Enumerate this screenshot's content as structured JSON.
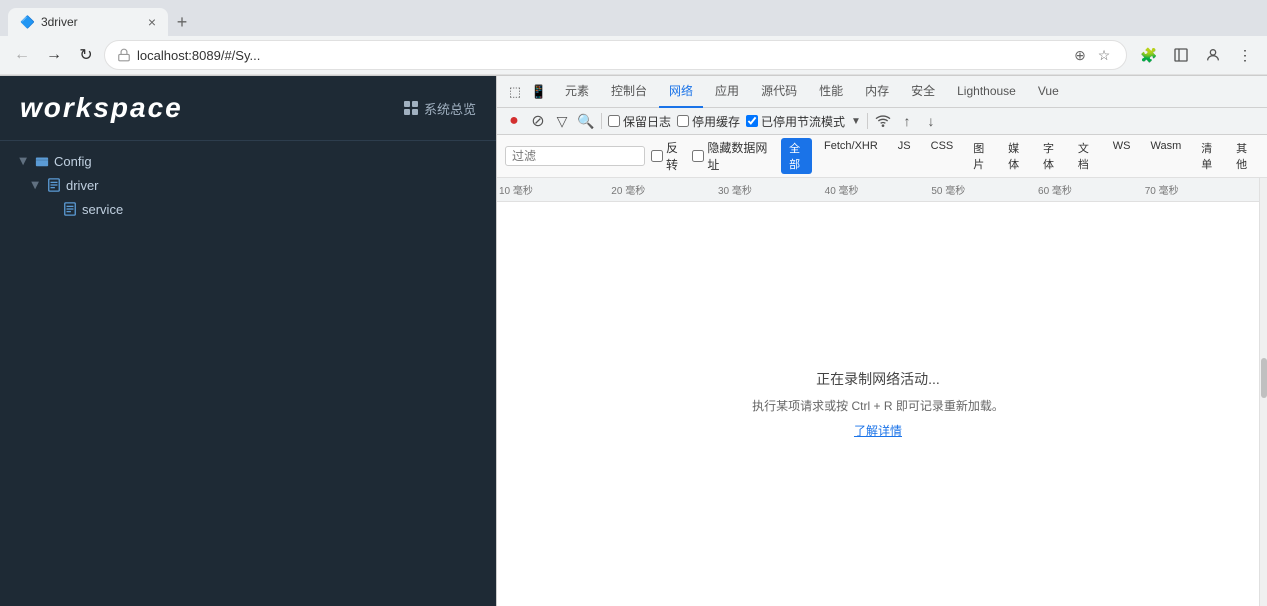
{
  "browser": {
    "tab_title": "3driver",
    "address": "localhost:8089/#/Sy...",
    "new_tab_label": "+"
  },
  "devtools": {
    "tabs": [
      {
        "id": "elements",
        "label": "元素"
      },
      {
        "id": "console",
        "label": "控制台"
      },
      {
        "id": "network",
        "label": "网络",
        "active": true
      },
      {
        "id": "application",
        "label": "应用"
      },
      {
        "id": "sources",
        "label": "源代码"
      },
      {
        "id": "performance",
        "label": "性能"
      },
      {
        "id": "memory",
        "label": "内存"
      },
      {
        "id": "security",
        "label": "安全"
      },
      {
        "id": "lighthouse",
        "label": "Lighthouse"
      },
      {
        "id": "vue",
        "label": "Vue"
      }
    ],
    "network": {
      "record_btn": "●",
      "stop_btn": "⊘",
      "filter_btn": "▽",
      "search_btn": "🔍",
      "preserve_log_label": "保留日志",
      "disable_cache_label": "停用缓存",
      "no_throttle_label": "已停用节流模式",
      "wifi_icon": "wifi",
      "import_icon": "↑",
      "export_icon": "↓",
      "filter_placeholder": "过滤",
      "invert_label": "反转",
      "hide_data_url_label": "隐藏数据网址",
      "filter_tags": [
        "全部",
        "Fetch/XHR",
        "JS",
        "CSS",
        "图片",
        "媒体",
        "字体",
        "文档",
        "WS",
        "Wasm",
        "清单",
        "其他"
      ],
      "active_tag": "全部",
      "timeline_ticks": [
        {
          "label": "10 毫秒",
          "pos": 0
        },
        {
          "label": "20 毫秒",
          "pos": 14.28
        },
        {
          "label": "30 毫秒",
          "pos": 28.57
        },
        {
          "label": "40 毫秒",
          "pos": 42.86
        },
        {
          "label": "50 毫秒",
          "pos": 57.14
        },
        {
          "label": "60 毫秒",
          "pos": 71.43
        },
        {
          "label": "70毫秒",
          "pos": 85.71
        }
      ],
      "empty_title": "正在录制网络活动...",
      "empty_sub": "执行某项请求或按 Ctrl + R 即可记录重新加载。",
      "empty_link": "了解详情"
    }
  },
  "app": {
    "logo": "workspace",
    "overview_label": "系统总览",
    "tree": {
      "config": {
        "label": "Config",
        "expanded": true,
        "children": {
          "driver": {
            "label": "driver",
            "expanded": true,
            "children": {
              "service": {
                "label": "service"
              }
            }
          }
        }
      }
    }
  }
}
